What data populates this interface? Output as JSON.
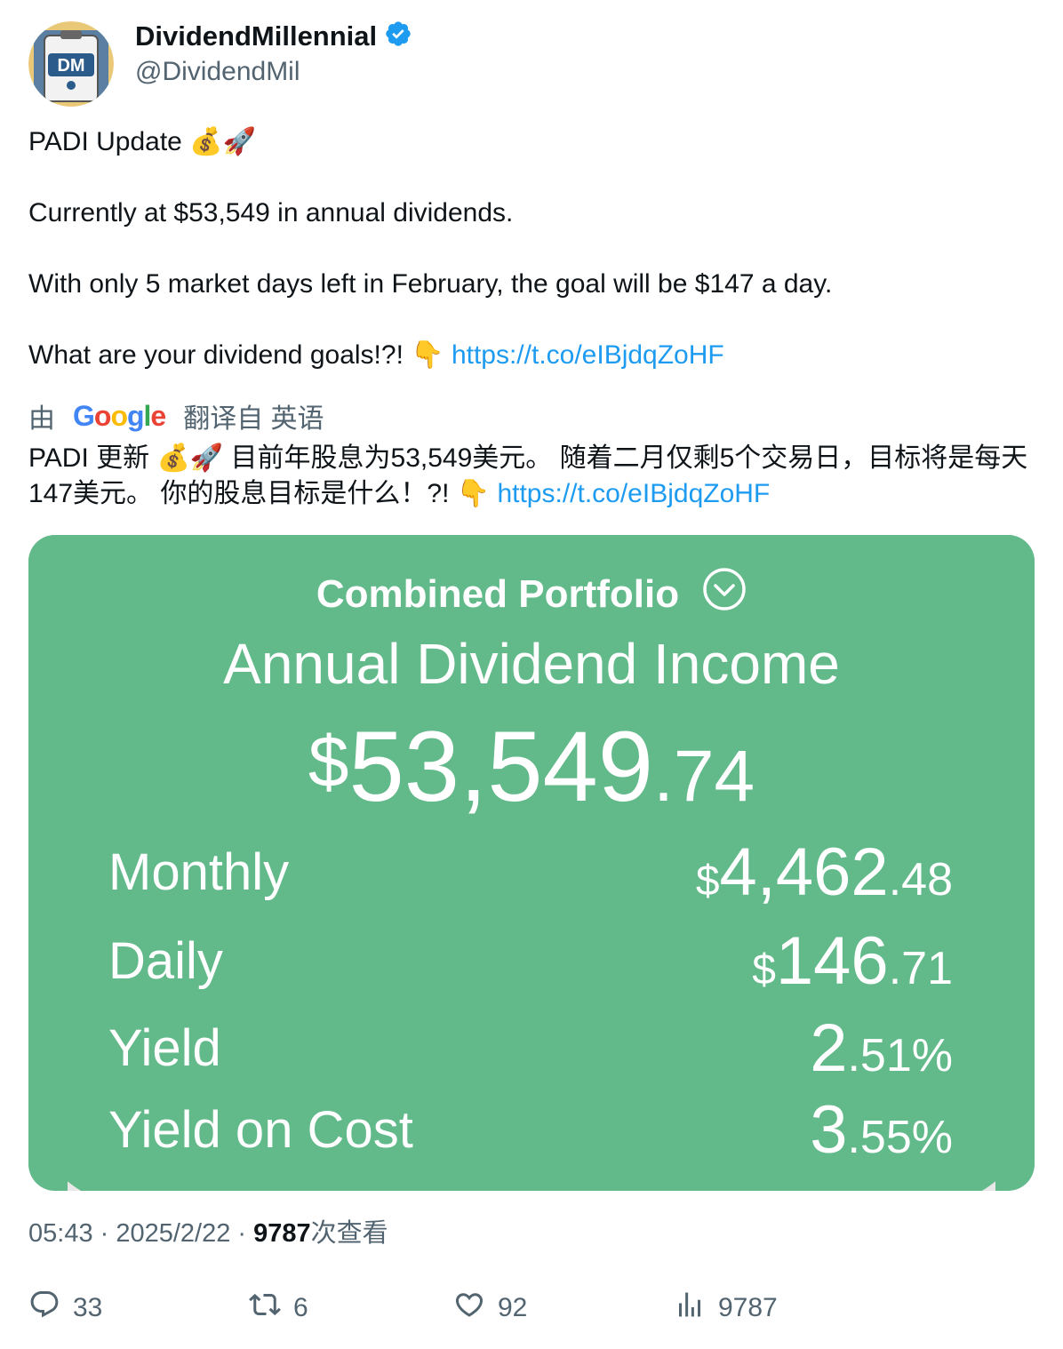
{
  "author": {
    "name": "DividendMillennial",
    "handle": "@DividendMil",
    "avatar_text": "DM"
  },
  "tweet": {
    "line1": "PADI Update 💰🚀",
    "line2": "Currently at $53,549 in annual dividends.",
    "line3": "With only 5 market days left in February, the goal will be $147 a day.",
    "line4_text": "What are your dividend goals!?! 👇",
    "link": "https://t.co/eIBjdqZoHF"
  },
  "translation": {
    "prefix": "由",
    "google": "Google",
    "suffix": "翻译自 英语",
    "text": "PADI 更新 💰🚀 目前年股息为53,549美元。 随着二月仅剩5个交易日，目标将是每天147美元。 你的股息目标是什么！?! 👇",
    "link": "https://t.co/eIBjdqZoHF"
  },
  "card": {
    "portfolio_title": "Combined Portfolio",
    "heading": "Annual Dividend Income",
    "total": {
      "currency": "$",
      "int": "53,549",
      "dec": ".74"
    },
    "rows": [
      {
        "label": "Monthly",
        "currency": "$",
        "int": "4,462",
        "dec": ".48"
      },
      {
        "label": "Daily",
        "currency": "$",
        "int": "146",
        "dec": ".71"
      },
      {
        "label": "Yield",
        "currency": "",
        "int": "2",
        "dec": ".51%"
      },
      {
        "label": "Yield on Cost",
        "currency": "",
        "int": "3",
        "dec": ".55%"
      }
    ]
  },
  "meta": {
    "time": "05:43",
    "sep1": " · ",
    "date": "2025/2/22",
    "sep2": " · ",
    "views": "9787",
    "views_label": "次查看"
  },
  "actions": {
    "replies": "33",
    "retweets": "6",
    "likes": "92",
    "views": "9787"
  },
  "colors": {
    "card_green": "#62b98a",
    "link": "#1d9bf0",
    "verified": "#1d9bf0",
    "muted": "#536471"
  }
}
